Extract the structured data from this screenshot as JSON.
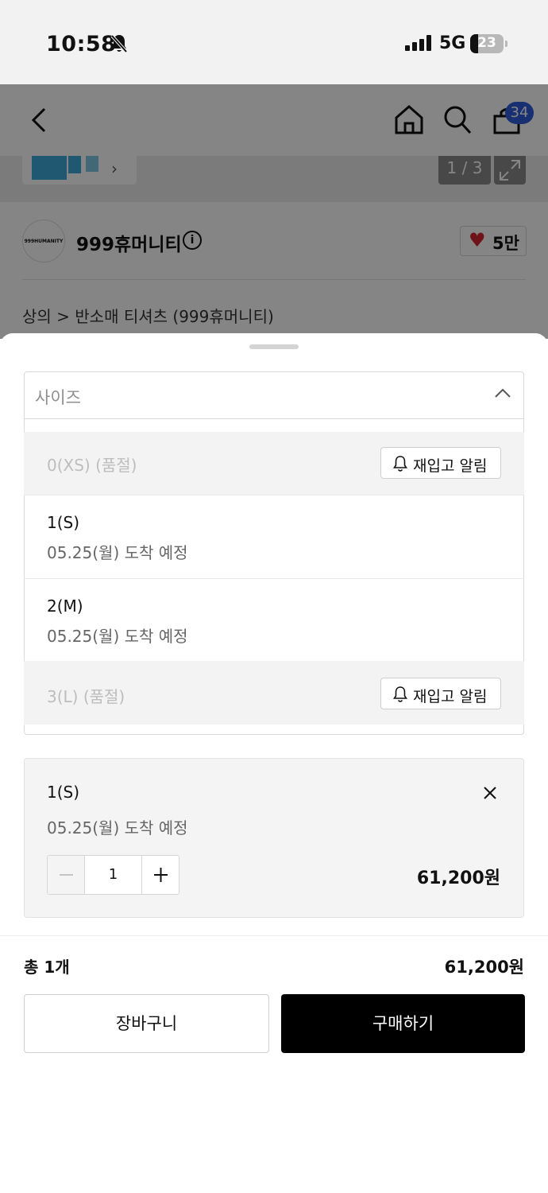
{
  "status_bar": {
    "time": "10:58",
    "network": "5G",
    "battery": "23"
  },
  "background_page": {
    "cart_badge": "34",
    "image_counter": "1 / 3",
    "brand_logo_text": "999HUMANITY",
    "brand_name": "999휴머니티",
    "like_count": "5만",
    "breadcrumb": "상의 > 반소매 티셔츠 (999휴머니티)"
  },
  "sheet": {
    "size_dropdown": {
      "label": "사이즈"
    },
    "options": [
      {
        "name": "0(XS) (품절)",
        "sold_out": true,
        "restock_label": "재입고 알림"
      },
      {
        "name": "1(S)",
        "sold_out": false,
        "delivery": "05.25(월) 도착 예정"
      },
      {
        "name": "2(M)",
        "sold_out": false,
        "delivery": "05.25(월) 도착 예정"
      },
      {
        "name": "3(L) (품절)",
        "sold_out": true,
        "restock_label": "재입고 알림"
      }
    ],
    "selected_item": {
      "name": "1(S)",
      "delivery": "05.25(월) 도착 예정",
      "quantity": "1",
      "price": "61,200원"
    },
    "total": {
      "label": "총 1개",
      "price": "61,200원"
    },
    "buttons": {
      "cart": "장바구니",
      "buy": "구매하기"
    }
  },
  "colors": {
    "accent_heart": "#d3262e",
    "badge": "#2f5bd8",
    "buy_button": "#000000"
  }
}
